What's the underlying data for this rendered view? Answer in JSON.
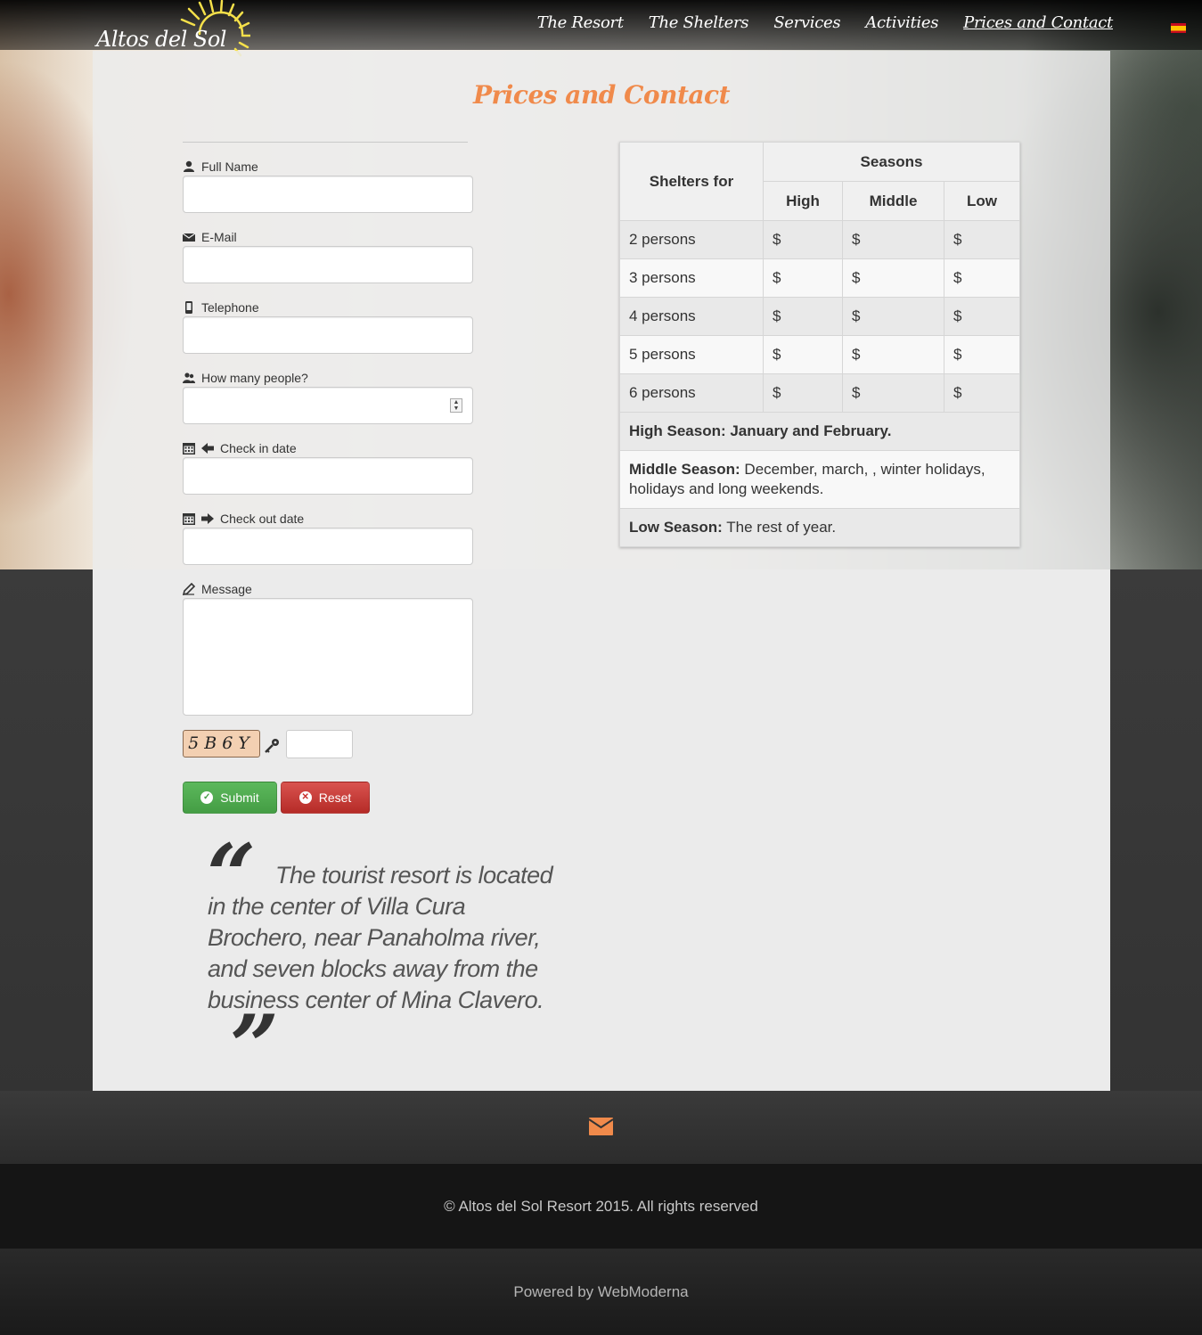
{
  "brand": {
    "logo_text": "Altos del Sol"
  },
  "nav": {
    "items": [
      "The Resort",
      "The Shelters",
      "Services",
      "Activities",
      "Prices and Contact"
    ],
    "active_index": 4
  },
  "page": {
    "title": "Prices and Contact"
  },
  "form": {
    "full_name_label": "Full Name",
    "email_label": "E-Mail",
    "telephone_label": "Telephone",
    "people_label": "How many people?",
    "checkin_label": "Check in date",
    "checkout_label": "Check out date",
    "message_label": "Message",
    "captcha_text": "5B6Y",
    "submit_label": "Submit",
    "reset_label": "Reset"
  },
  "quote": {
    "text": "The tourist resort is located in the center of Villa Cura Brochero, near Panaholma river, and seven blocks away from the business center of Mina Clavero."
  },
  "prices": {
    "col_shelters": "Shelters for",
    "col_seasons": "Seasons",
    "col_high": "High",
    "col_middle": "Middle",
    "col_low": "Low",
    "rows": [
      {
        "label": "2 persons",
        "high": "$",
        "middle": "$",
        "low": "$"
      },
      {
        "label": "3 persons",
        "high": "$",
        "middle": "$",
        "low": "$"
      },
      {
        "label": "4 persons",
        "high": "$",
        "middle": "$",
        "low": "$"
      },
      {
        "label": "5 persons",
        "high": "$",
        "middle": "$",
        "low": "$"
      },
      {
        "label": "6 persons",
        "high": "$",
        "middle": "$",
        "low": "$"
      }
    ],
    "high_note": "High Season: January and February.",
    "middle_note_bold": "Middle Season:",
    "middle_note_text": "December, march, , winter holidays, holidays and long weekends.",
    "low_note_bold": "Low Season:",
    "low_note_text": "The rest of year."
  },
  "footer": {
    "copyright": "© Altos del Sol Resort 2015. All rights reserved",
    "powered": "Powered by  WebModerna"
  },
  "colors": {
    "accent": "#f08a4b",
    "submit": "#5cb85c",
    "reset": "#d9534f"
  }
}
